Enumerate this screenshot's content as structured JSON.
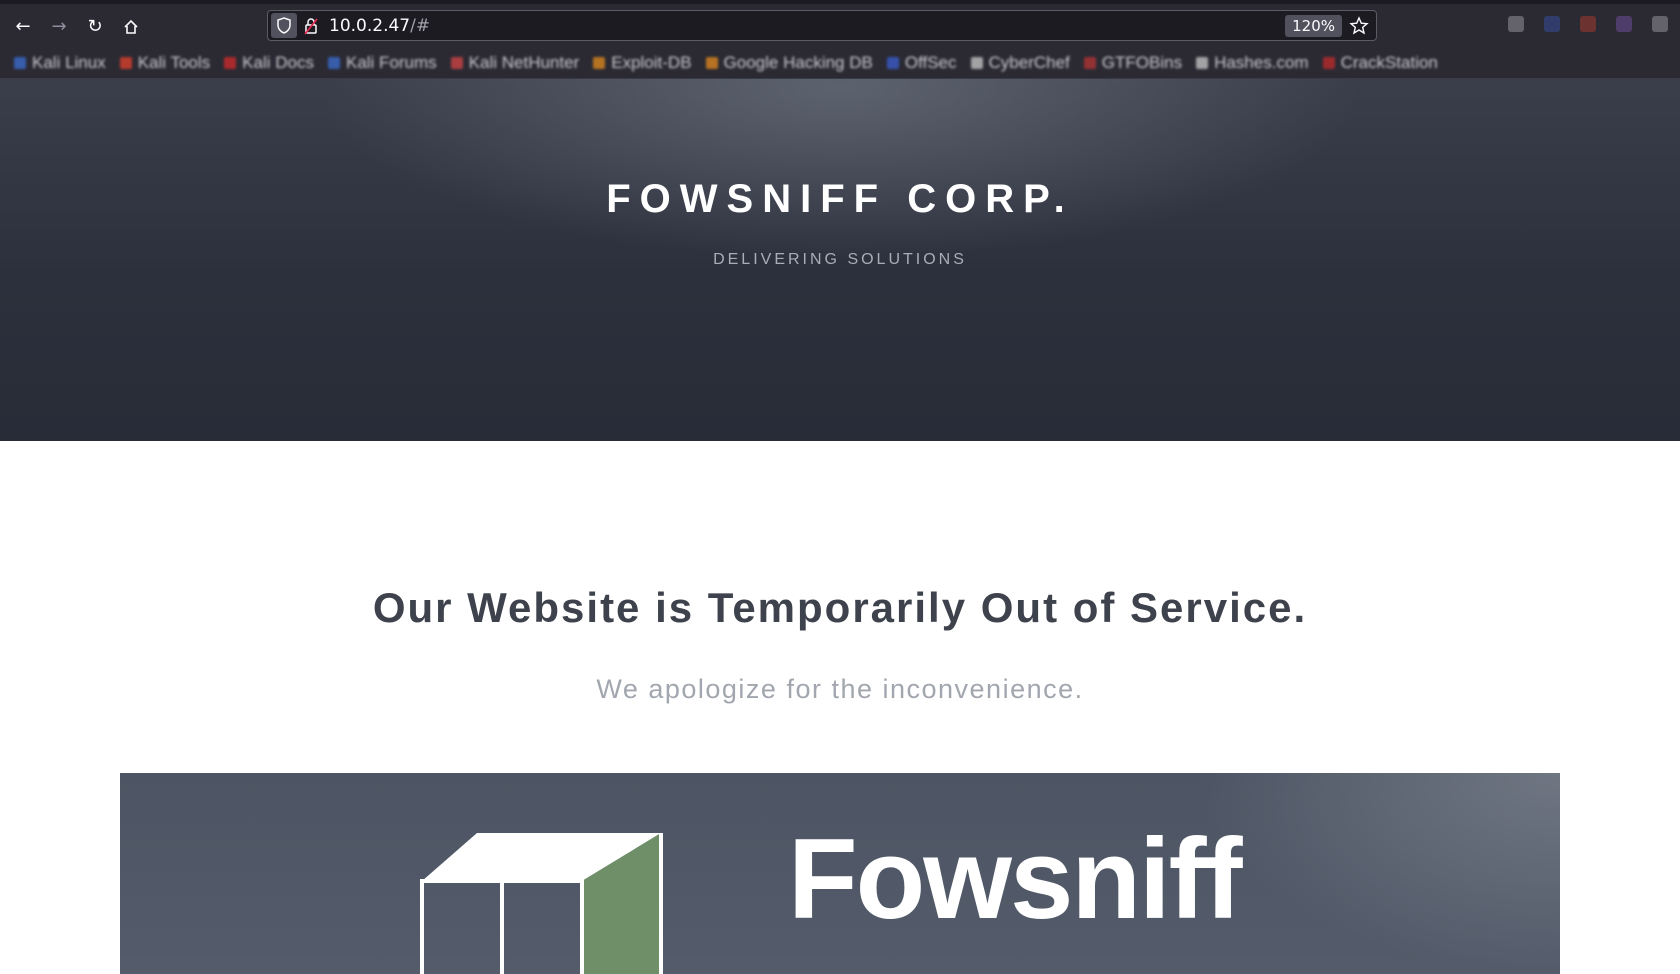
{
  "browser": {
    "url_host": "10.0.2.47",
    "url_path": "/#",
    "zoom": "120%",
    "bookmarks": [
      {
        "label": "Kali Linux",
        "color": "#3b6fd4"
      },
      {
        "label": "Kali Tools",
        "color": "#e3412c"
      },
      {
        "label": "Kali Docs",
        "color": "#d42a2a"
      },
      {
        "label": "Kali Forums",
        "color": "#3b6fd4"
      },
      {
        "label": "Kali NetHunter",
        "color": "#d64545"
      },
      {
        "label": "Exploit-DB",
        "color": "#e38a1c"
      },
      {
        "label": "Google Hacking DB",
        "color": "#e38a1c"
      },
      {
        "label": "OffSec",
        "color": "#3b5fd4"
      },
      {
        "label": "CyberChef",
        "color": "#cccccc"
      },
      {
        "label": "GTFOBins",
        "color": "#b83434"
      },
      {
        "label": "Hashes.com",
        "color": "#cccccc"
      },
      {
        "label": "CrackStation",
        "color": "#c22b2b"
      }
    ]
  },
  "hero": {
    "title": "FOWSNIFF CORP.",
    "subtitle": "DELIVERING SOLUTIONS"
  },
  "main": {
    "heading": "Our Website is Temporarily Out of Service.",
    "subheading": "We apologize for the inconvenience."
  },
  "banner": {
    "logo_text": "Fowsniff",
    "accent_color": "#6f8f68"
  }
}
